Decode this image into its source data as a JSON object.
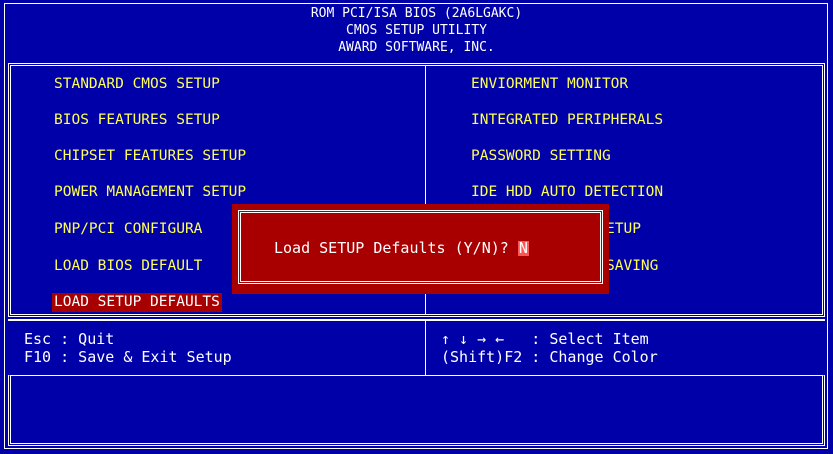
{
  "header": {
    "line1": "ROM PCI/ISA BIOS (2A6LGAKC)",
    "line2": "CMOS SETUP UTILITY",
    "line3": "AWARD SOFTWARE, INC."
  },
  "menu": {
    "left": [
      {
        "label": "STANDARD CMOS SETUP"
      },
      {
        "label": "BIOS FEATURES SETUP"
      },
      {
        "label": "CHIPSET FEATURES SETUP"
      },
      {
        "label": "POWER MANAGEMENT SETUP"
      },
      {
        "label": "PNP/PCI CONFIGURA"
      },
      {
        "label": "LOAD BIOS DEFAULT"
      },
      {
        "label": "LOAD SETUP DEFAULTS"
      }
    ],
    "right": [
      {
        "label": "ENVIORMENT MONITOR"
      },
      {
        "label": "INTEGRATED PERIPHERALS"
      },
      {
        "label": "PASSWORD SETTING"
      },
      {
        "label": "IDE HDD AUTO DETECTION"
      },
      {
        "label": "ETUP"
      },
      {
        "label": "SAVING"
      }
    ],
    "selected": "LOAD SETUP DEFAULTS"
  },
  "help": {
    "esc": "Esc : Quit",
    "f10": "F10 : Save & Exit Setup",
    "arrows": "↑ ↓ → ←   : Select Item",
    "shift_f2": "(Shift)F2 : Change Color"
  },
  "dialog": {
    "prompt": "Load SETUP Defaults (Y/N)? ",
    "answer": "N"
  },
  "colors": {
    "background": "#0000a8",
    "menu_text": "#ffff54",
    "dialog_bg": "#a80000",
    "selection_bg": "#a80000",
    "frame": "#ffffff"
  }
}
